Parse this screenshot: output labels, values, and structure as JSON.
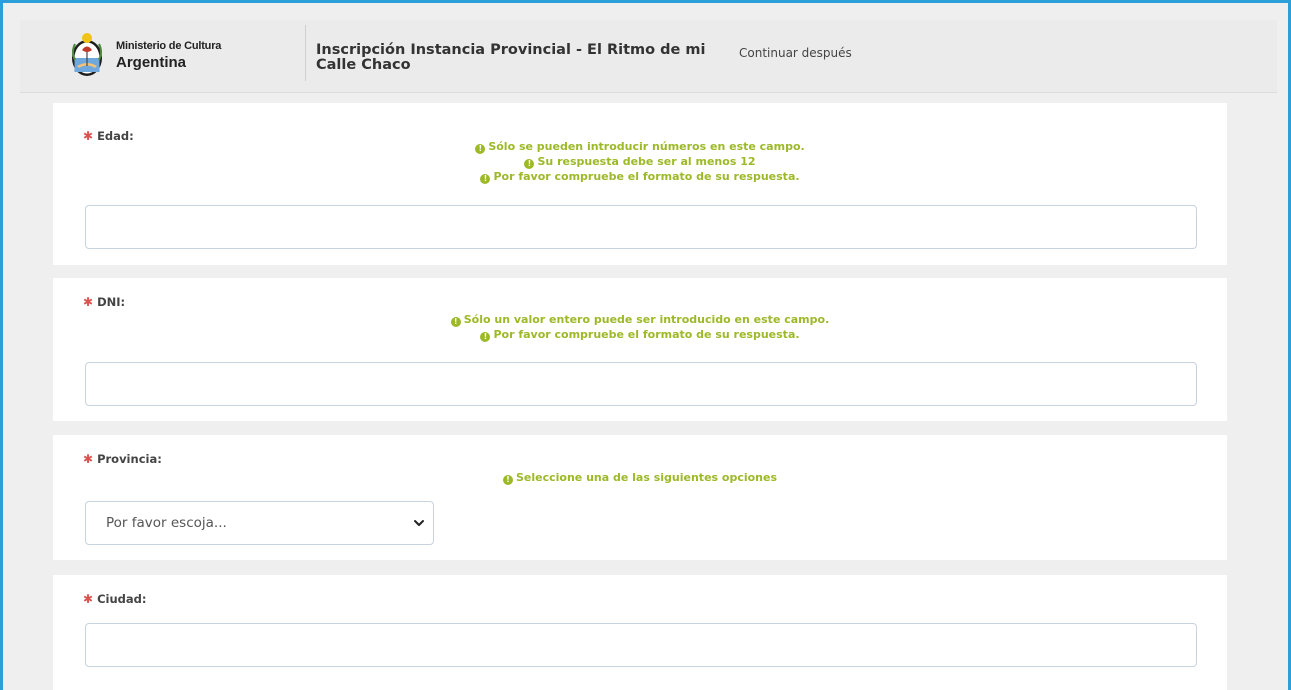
{
  "header": {
    "logo_line1": "Ministerio de Cultura",
    "logo_line2": "Argentina",
    "survey_title": "Inscripción Instancia Provincial - El Ritmo de mi Calle Chaco",
    "continue_later": "Continuar después"
  },
  "colors": {
    "frame_border": "#2a9fd8",
    "tip_green": "#9cb927",
    "required_red": "#d9534f"
  },
  "questions": [
    {
      "label": "Edad:",
      "tips": [
        "Sólo se pueden introducir números en este campo.",
        "Su respuesta debe ser al menos 12",
        "Por favor compruebe el formato de su respuesta."
      ],
      "value": ""
    },
    {
      "label": "DNI:",
      "tips": [
        "Sólo un valor entero puede ser introducido en este campo.",
        "Por favor compruebe el formato de su respuesta."
      ],
      "value": ""
    },
    {
      "label": "Provincia:",
      "tips": [
        "Seleccione una de las siguientes opciones"
      ],
      "select_value": "Por favor escoja..."
    },
    {
      "label": "Ciudad:",
      "value": ""
    }
  ],
  "icons": {
    "required": "asterisk-icon",
    "tip": "exclamation-circle-icon",
    "select": "chevron-down-icon",
    "logo": "argentina-seal-icon"
  }
}
